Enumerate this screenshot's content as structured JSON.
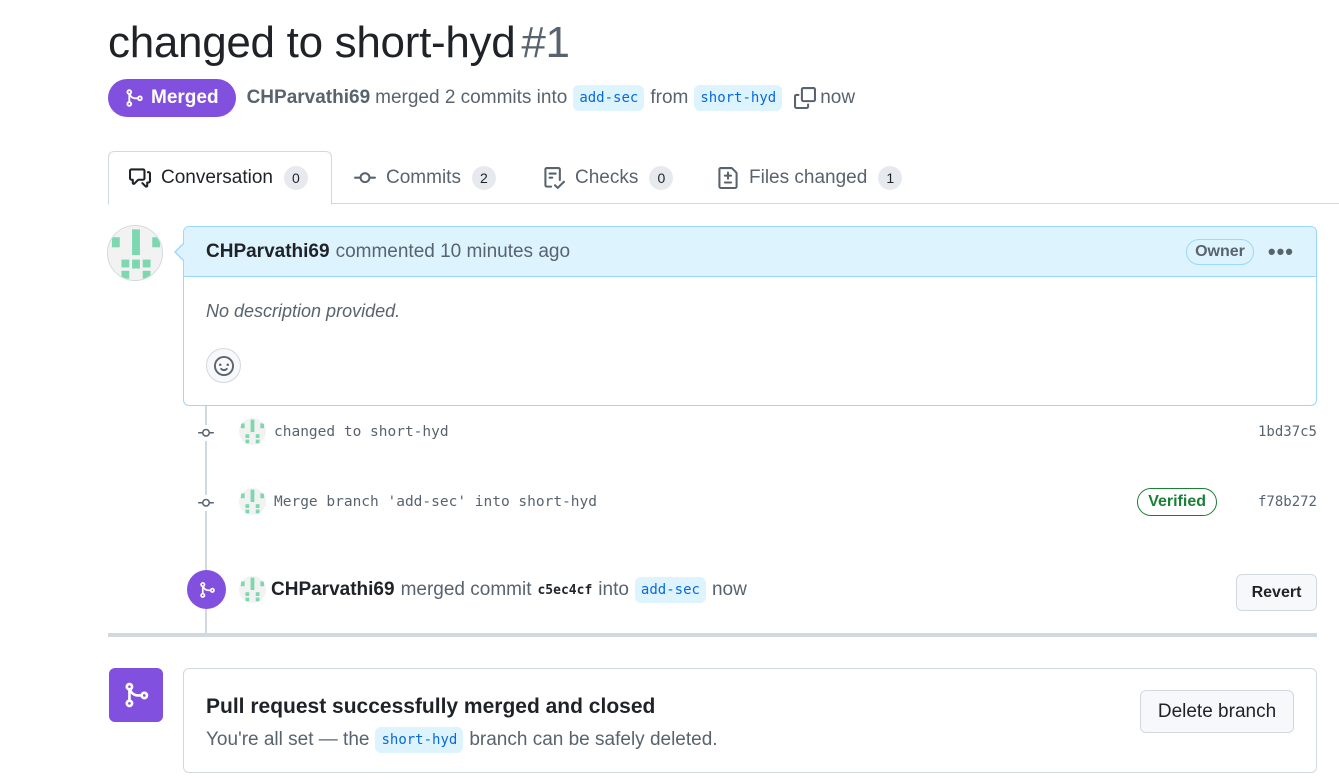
{
  "pr": {
    "title": "changed to short-hyd",
    "number": "#1",
    "state": "Merged",
    "author": "CHParvathi69",
    "merge_summary": "merged 2 commits into",
    "base_branch": "add-sec",
    "from_word": "from",
    "head_branch": "short-hyd",
    "time": "now"
  },
  "tabs": [
    {
      "label": "Conversation",
      "count": "0",
      "icon": "comment-discussion-icon"
    },
    {
      "label": "Commits",
      "count": "2",
      "icon": "git-commit-icon"
    },
    {
      "label": "Checks",
      "count": "0",
      "icon": "checklist-icon"
    },
    {
      "label": "Files changed",
      "count": "1",
      "icon": "file-diff-icon"
    }
  ],
  "comment": {
    "author": "CHParvathi69",
    "action": "commented 10 minutes ago",
    "role": "Owner",
    "body": "No description provided."
  },
  "commits": [
    {
      "message": "changed to short-hyd",
      "sha": "1bd37c5",
      "verified": ""
    },
    {
      "message": "Merge branch 'add-sec' into short-hyd",
      "sha": "f78b272",
      "verified": "Verified"
    }
  ],
  "merge_event": {
    "author": "CHParvathi69",
    "text": "merged commit",
    "sha": "c5ec4cf",
    "into": "into",
    "branch": "add-sec",
    "time": "now",
    "revert_label": "Revert"
  },
  "merged_box": {
    "title": "Pull request successfully merged and closed",
    "sub_before": "You're all set — the",
    "branch": "short-hyd",
    "sub_after": "branch can be safely deleted.",
    "delete_label": "Delete branch"
  },
  "colors": {
    "merged_purple": "#8250df",
    "branch_bg": "#ddf4ff",
    "branch_fg": "#0969da",
    "verified_green": "#1a7f37"
  }
}
